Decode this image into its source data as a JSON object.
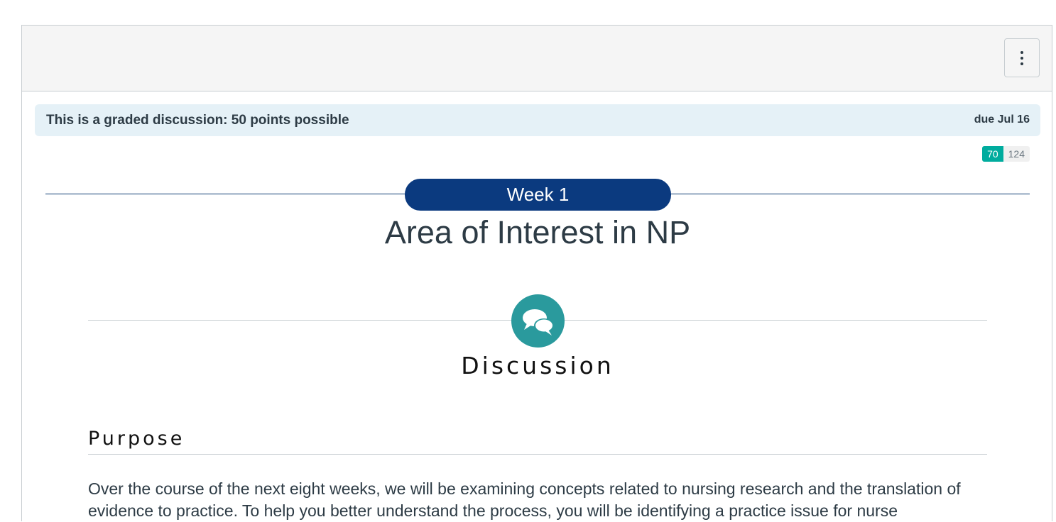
{
  "toolbar": {
    "menu_icon": "kebab-vertical-icon"
  },
  "banner": {
    "graded_text": "This is a graded discussion: 50 points possible",
    "due_text": "due Jul 16",
    "background_color": "#e5f1f7"
  },
  "replies": {
    "unread": "70",
    "total": "124",
    "unread_color": "#00ac9e"
  },
  "content": {
    "week_label": "Week 1",
    "week_color": "#0b3a7f",
    "title": "Area of Interest in NP",
    "discussion_icon": "speech-bubbles-icon",
    "discussion_icon_color": "#2a9a9d",
    "discussion_heading": "Discussion",
    "purpose_heading": "Purpose",
    "purpose_text": "Over the course of the next eight weeks, we will be examining concepts related to nursing research and the translation of evidence to practice. To help you better understand the process, you will be identifying a practice issue for nurse"
  }
}
